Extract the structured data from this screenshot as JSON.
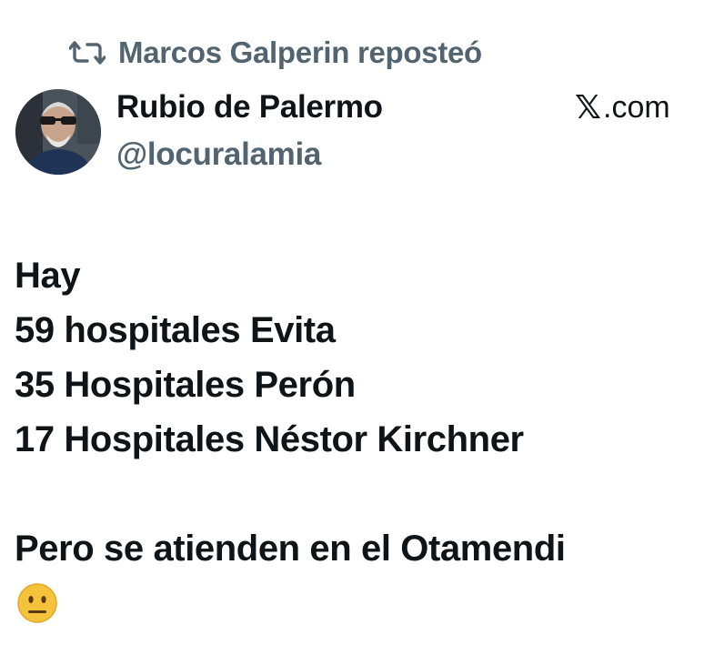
{
  "repost": {
    "icon": "repost-icon",
    "text": "Marcos Galperin reposteó"
  },
  "author": {
    "avatar": "avatar",
    "display_name": "Rubio de Palermo",
    "handle": "@locuralamia"
  },
  "source": {
    "logo": "𝕏",
    "text": ".com"
  },
  "tweet": {
    "lines": [
      "Hay",
      "59 hospitales Evita",
      "35 Hospitales Perón",
      "17 Hospitales Néstor Kirchner"
    ],
    "closing": "Pero se atienden en el Otamendi",
    "emoji": "neutral-face-emoji"
  },
  "colors": {
    "text": "#0f1419",
    "secondary": "#536471",
    "emoji": "#f5c33b"
  }
}
